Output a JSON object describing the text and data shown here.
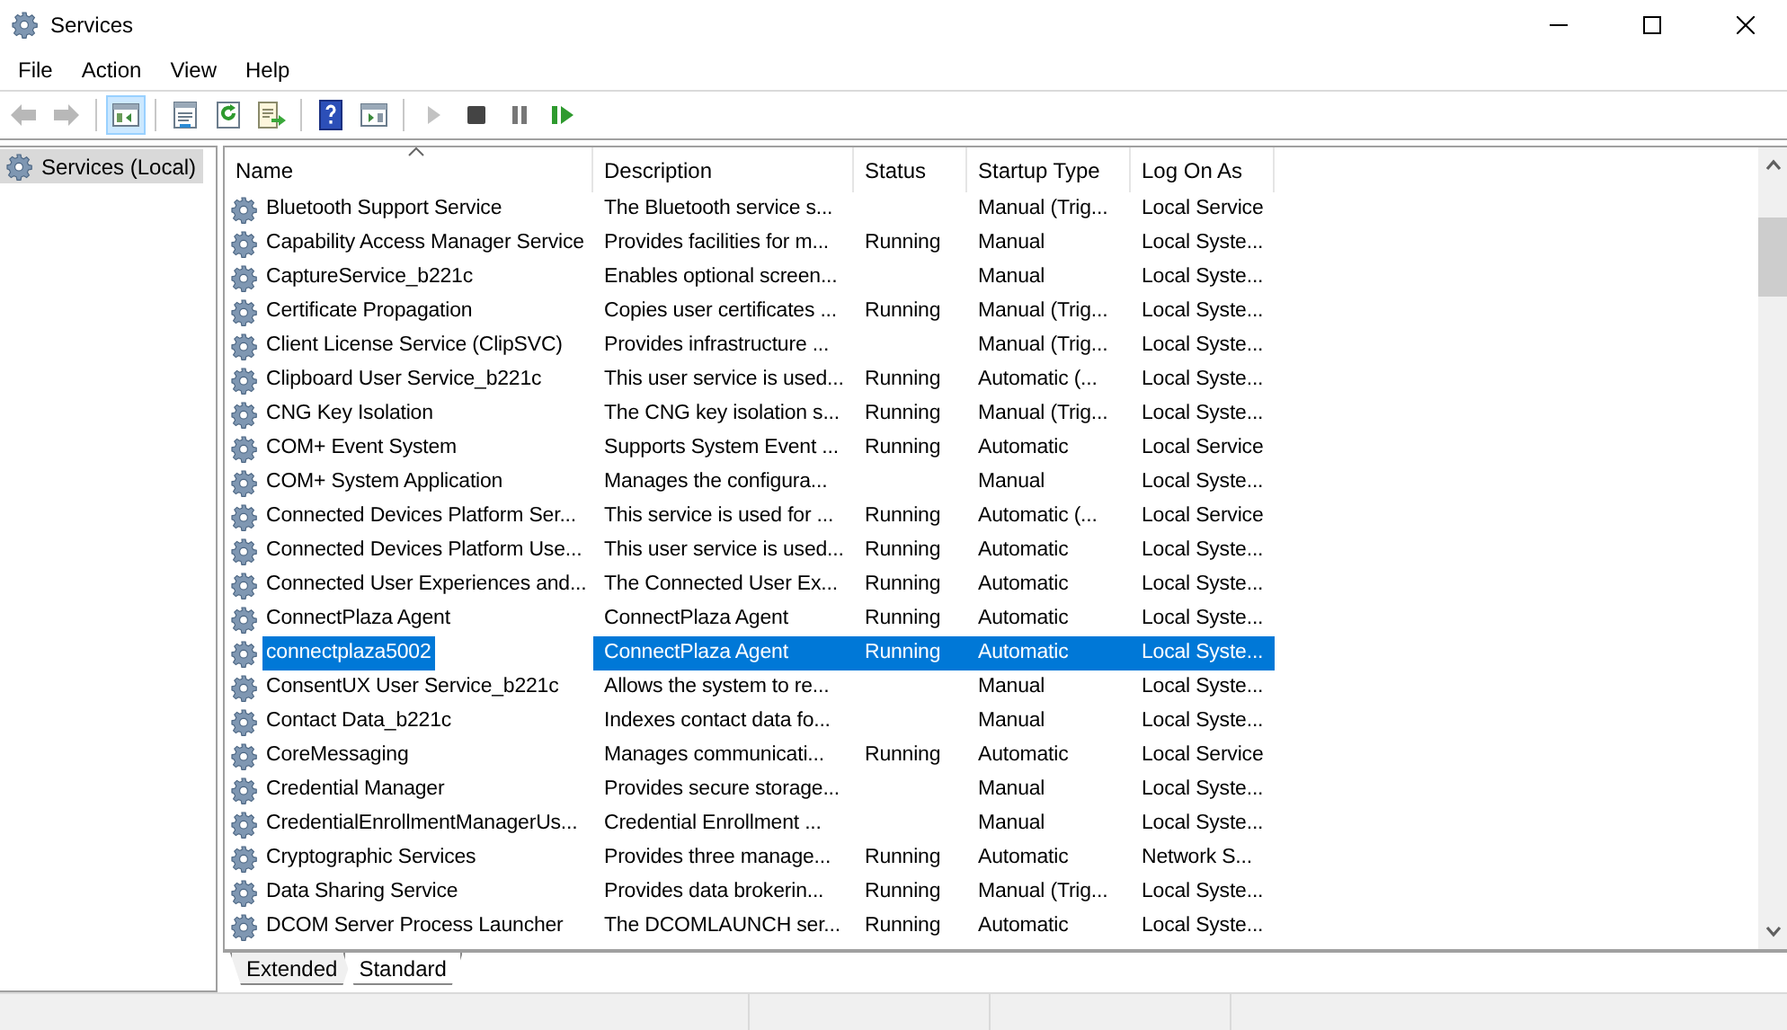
{
  "window": {
    "title": "Services"
  },
  "menu": [
    "File",
    "Action",
    "View",
    "Help"
  ],
  "toolbar": [
    {
      "kind": "back",
      "disabled": true,
      "selected": false
    },
    {
      "kind": "forward",
      "disabled": true,
      "selected": false
    },
    {
      "kind": "tree-toggle",
      "disabled": false,
      "selected": true
    },
    {
      "kind": "properties",
      "disabled": false,
      "selected": false
    },
    {
      "kind": "refresh",
      "disabled": false,
      "selected": false
    },
    {
      "kind": "export",
      "disabled": false,
      "selected": false
    },
    {
      "kind": "help",
      "disabled": false,
      "selected": false
    },
    {
      "kind": "action-pane",
      "disabled": false,
      "selected": false
    },
    {
      "kind": "start",
      "disabled": true,
      "selected": false
    },
    {
      "kind": "stop",
      "disabled": false,
      "selected": false
    },
    {
      "kind": "pause",
      "disabled": false,
      "selected": false
    },
    {
      "kind": "restart",
      "disabled": false,
      "selected": false
    }
  ],
  "tree": [
    {
      "label": "Services (Local)",
      "selected": true
    }
  ],
  "table": {
    "columns": [
      {
        "label": "Name",
        "sorted": true
      },
      {
        "label": "Description",
        "sorted": false
      },
      {
        "label": "Status",
        "sorted": false
      },
      {
        "label": "Startup Type",
        "sorted": false
      },
      {
        "label": "Log On As",
        "sorted": false
      }
    ],
    "rows": [
      {
        "name": "Bluetooth Support Service",
        "description": "The Bluetooth service s...",
        "startup_type": "Manual (Trig...",
        "log_on_as": "Local Service",
        "selected": false
      },
      {
        "name": "Capability Access Manager Service",
        "description": "Provides facilities for m...",
        "status": "Running",
        "startup_type": "Manual",
        "log_on_as": "Local Syste...",
        "selected": false
      },
      {
        "name": "CaptureService_b221c",
        "description": "Enables optional screen...",
        "startup_type": "Manual",
        "log_on_as": "Local Syste...",
        "selected": false
      },
      {
        "name": "Certificate Propagation",
        "description": "Copies user certificates ...",
        "status": "Running",
        "startup_type": "Manual (Trig...",
        "log_on_as": "Local Syste...",
        "selected": false
      },
      {
        "name": "Client License Service (ClipSVC)",
        "description": "Provides infrastructure ...",
        "startup_type": "Manual (Trig...",
        "log_on_as": "Local Syste...",
        "selected": false
      },
      {
        "name": "Clipboard User Service_b221c",
        "description": "This user service is used...",
        "status": "Running",
        "startup_type": "Automatic (...",
        "log_on_as": "Local Syste...",
        "selected": false
      },
      {
        "name": "CNG Key Isolation",
        "description": "The CNG key isolation s...",
        "status": "Running",
        "startup_type": "Manual (Trig...",
        "log_on_as": "Local Syste...",
        "selected": false
      },
      {
        "name": "COM+ Event System",
        "description": "Supports System Event ...",
        "status": "Running",
        "startup_type": "Automatic",
        "log_on_as": "Local Service",
        "selected": false
      },
      {
        "name": "COM+ System Application",
        "description": "Manages the configura...",
        "startup_type": "Manual",
        "log_on_as": "Local Syste...",
        "selected": false
      },
      {
        "name": "Connected Devices Platform Ser...",
        "description": "This service is used for ...",
        "status": "Running",
        "startup_type": "Automatic (...",
        "log_on_as": "Local Service",
        "selected": false
      },
      {
        "name": "Connected Devices Platform Use...",
        "description": "This user service is used...",
        "status": "Running",
        "startup_type": "Automatic",
        "log_on_as": "Local Syste...",
        "selected": false
      },
      {
        "name": "Connected User Experiences and...",
        "description": "The Connected User Ex...",
        "status": "Running",
        "startup_type": "Automatic",
        "log_on_as": "Local Syste...",
        "selected": false
      },
      {
        "name": "ConnectPlaza Agent",
        "description": "ConnectPlaza Agent",
        "status": "Running",
        "startup_type": "Automatic",
        "log_on_as": "Local Syste...",
        "selected": false
      },
      {
        "name": "connectplaza5002",
        "description": "ConnectPlaza Agent",
        "status": "Running",
        "startup_type": "Automatic",
        "log_on_as": "Local Syste...",
        "selected": true
      },
      {
        "name": "ConsentUX User Service_b221c",
        "description": "Allows the system to re...",
        "startup_type": "Manual",
        "log_on_as": "Local Syste...",
        "selected": false
      },
      {
        "name": "Contact Data_b221c",
        "description": "Indexes contact data fo...",
        "startup_type": "Manual",
        "log_on_as": "Local Syste...",
        "selected": false
      },
      {
        "name": "CoreMessaging",
        "description": "Manages communicati...",
        "status": "Running",
        "startup_type": "Automatic",
        "log_on_as": "Local Service",
        "selected": false
      },
      {
        "name": "Credential Manager",
        "description": "Provides secure storage...",
        "startup_type": "Manual",
        "log_on_as": "Local Syste...",
        "selected": false
      },
      {
        "name": "CredentialEnrollmentManagerUs...",
        "description": "Credential Enrollment ...",
        "startup_type": "Manual",
        "log_on_as": "Local Syste...",
        "selected": false
      },
      {
        "name": "Cryptographic Services",
        "description": "Provides three manage...",
        "status": "Running",
        "startup_type": "Automatic",
        "log_on_as": "Network S...",
        "selected": false
      },
      {
        "name": "Data Sharing Service",
        "description": "Provides data brokerin...",
        "status": "Running",
        "startup_type": "Manual (Trig...",
        "log_on_as": "Local Syste...",
        "selected": false
      },
      {
        "name": "DCOM Server Process Launcher",
        "description": "The DCOMLAUNCH ser...",
        "status": "Running",
        "startup_type": "Automatic",
        "log_on_as": "Local Syste...",
        "selected": false
      }
    ]
  },
  "view_tabs": [
    {
      "label": "Extended",
      "selected": false
    },
    {
      "label": "Standard",
      "selected": true
    }
  ]
}
